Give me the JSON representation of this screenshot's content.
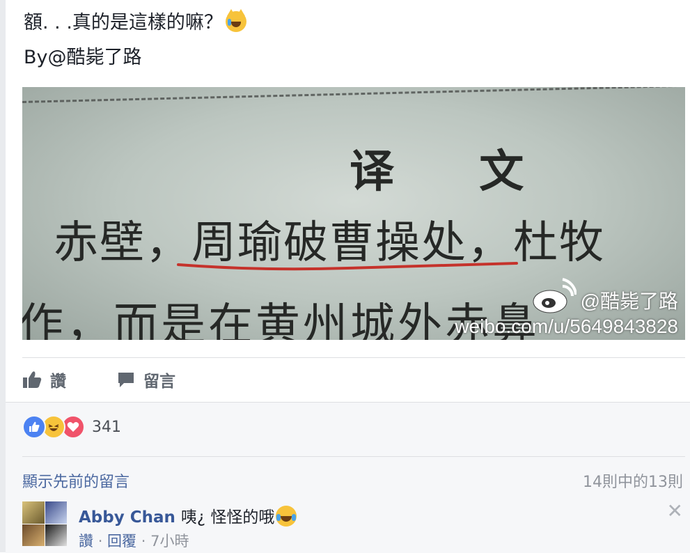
{
  "post": {
    "caption_line1": "額. . .真的是這樣的嘛？",
    "caption_line1_emoji": "cat-tears-of-joy-icon",
    "caption_line2": "By@酷毙了路",
    "image": {
      "heading": "译  文",
      "line1": "赤壁，周瑜破曹操处，杜牧",
      "line2": "作，而是在黄州城外赤鼻",
      "watermark_handle": "@酷毙了路",
      "watermark_url": "weibo.com/u/5649843828"
    },
    "actions": {
      "like_label": "讚",
      "comment_label": "留言"
    }
  },
  "reactions": {
    "icons": [
      "like-reaction-icon",
      "haha-reaction-icon",
      "love-reaction-icon"
    ],
    "count": "341"
  },
  "comments": {
    "show_previous_label": "顯示先前的留言",
    "count_label": "14則中的13則",
    "items": [
      {
        "author": "Abby Chan",
        "text": "咦¿ 怪怪的哦",
        "emoji": "haha-icon",
        "like_label": "讚",
        "reply_label": "回覆",
        "time": "7小時"
      }
    ]
  },
  "colors": {
    "link": "#4b68a0",
    "author": "#385898",
    "like_blue": "#4c82f2",
    "love_red": "#f0536a",
    "haha_yellow": "#f7c33b",
    "muted": "#90949c"
  }
}
